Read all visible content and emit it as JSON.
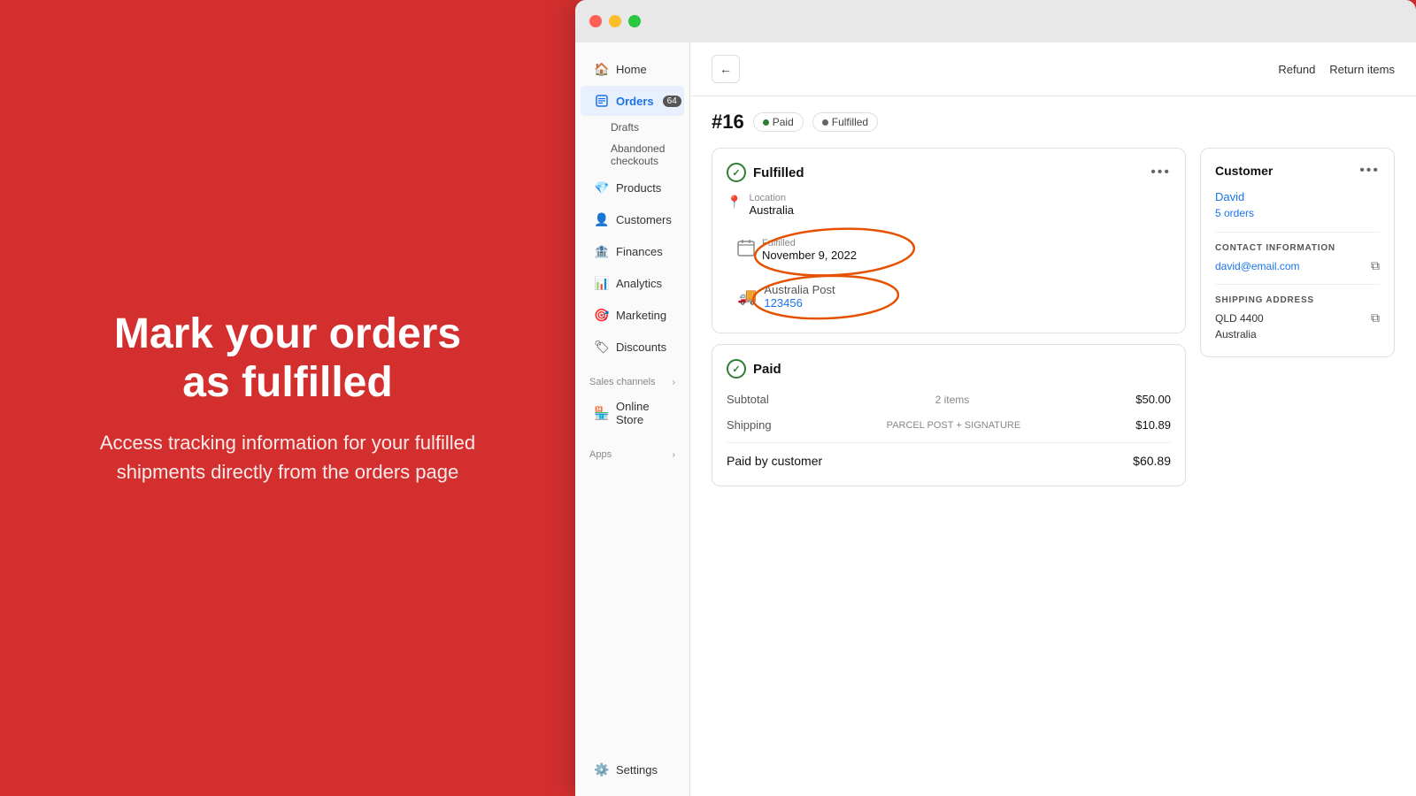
{
  "left": {
    "headline_line1": "Mark your orders",
    "headline_line2": "as fulfilled",
    "description": "Access tracking information for your fulfilled shipments directly from the orders page"
  },
  "browser": {
    "traffic_lights": [
      "red",
      "yellow",
      "green"
    ]
  },
  "sidebar": {
    "items": [
      {
        "id": "home",
        "label": "Home",
        "icon": "🏠",
        "active": false
      },
      {
        "id": "orders",
        "label": "Orders",
        "icon": "📋",
        "active": true,
        "badge": "64"
      },
      {
        "id": "drafts",
        "label": "Drafts",
        "sub": true
      },
      {
        "id": "abandoned",
        "label": "Abandoned checkouts",
        "sub": true
      },
      {
        "id": "products",
        "label": "Products",
        "icon": "💎",
        "active": false
      },
      {
        "id": "customers",
        "label": "Customers",
        "icon": "👤",
        "active": false
      },
      {
        "id": "finances",
        "label": "Finances",
        "icon": "🏦",
        "active": false
      },
      {
        "id": "analytics",
        "label": "Analytics",
        "icon": "📊",
        "active": false
      },
      {
        "id": "marketing",
        "label": "Marketing",
        "icon": "🎯",
        "active": false
      },
      {
        "id": "discounts",
        "label": "Discounts",
        "icon": "🏷",
        "active": false
      }
    ],
    "sales_channels_label": "Sales channels",
    "online_store_label": "Online Store",
    "apps_label": "Apps",
    "settings_label": "Settings"
  },
  "header": {
    "refund_label": "Refund",
    "return_items_label": "Return items"
  },
  "order": {
    "number": "#16",
    "status_paid": "Paid",
    "status_fulfilled": "Fulfilled"
  },
  "fulfilled_card": {
    "title": "Fulfilled",
    "location_label": "Location",
    "location_value": "Australia",
    "fulfillment_label": "Fulfilled",
    "fulfillment_date": "November 9, 2022",
    "carrier": "Australia Post",
    "tracking_number": "123456"
  },
  "paid_card": {
    "title": "Paid",
    "subtotal_label": "Subtotal",
    "subtotal_items": "2 items",
    "subtotal_amount": "$50.00",
    "shipping_label": "Shipping",
    "shipping_method": "PARCEL POST + SIGNATURE",
    "shipping_amount": "$10.89",
    "paid_label": "Paid by customer",
    "paid_amount": "$60.89"
  },
  "customer_card": {
    "title": "Customer",
    "name": "David",
    "orders": "5 orders",
    "contact_label": "CONTACT INFORMATION",
    "email": "david@email.com",
    "shipping_label": "SHIPPING ADDRESS",
    "address_line1": "QLD 4400",
    "address_line2": "Australia"
  }
}
